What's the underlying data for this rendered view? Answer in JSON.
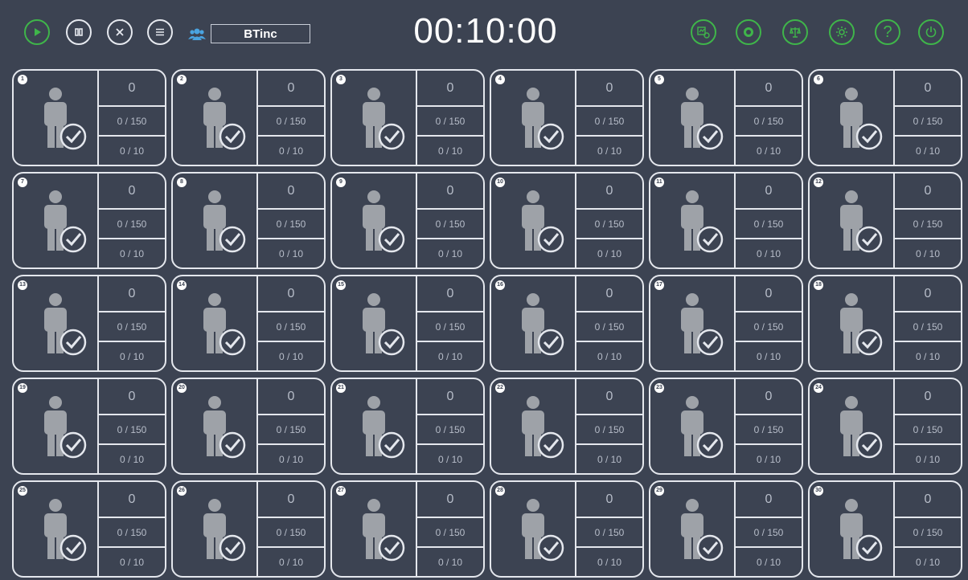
{
  "toolbar": {
    "left_buttons": [
      {
        "name": "play-button",
        "icon": "play-icon"
      },
      {
        "name": "pause-button",
        "icon": "pause-icon"
      },
      {
        "name": "stop-button",
        "icon": "close-icon"
      },
      {
        "name": "menu-button",
        "icon": "menu-icon"
      }
    ],
    "user_icon": "users-icon",
    "user_label": "BTinc",
    "timer": "00:10:00",
    "right_buttons": [
      {
        "name": "stats-button",
        "icon": "stats-icon"
      },
      {
        "name": "record-button",
        "icon": "record-icon"
      },
      {
        "name": "balance-button",
        "icon": "balance-icon"
      },
      {
        "name": "settings-button",
        "icon": "settings-icon"
      },
      {
        "name": "help-button",
        "icon": "help-icon",
        "glyph": "?"
      },
      {
        "name": "power-button",
        "icon": "power-icon"
      }
    ]
  },
  "colors": {
    "background": "#3c4352",
    "accent_green": "#3fb54a",
    "border": "#e4e7ed",
    "figure": "#9ea2a8",
    "value_text": "#b7bdc9",
    "user_icon": "#4aa3e0"
  },
  "stations": [
    {
      "number": "1",
      "value": "0",
      "progress": "0 / 150",
      "count": "0 / 10"
    },
    {
      "number": "2",
      "value": "0",
      "progress": "0 / 150",
      "count": "0 / 10"
    },
    {
      "number": "3",
      "value": "0",
      "progress": "0 / 150",
      "count": "0 / 10"
    },
    {
      "number": "4",
      "value": "0",
      "progress": "0 / 150",
      "count": "0 / 10"
    },
    {
      "number": "5",
      "value": "0",
      "progress": "0 / 150",
      "count": "0 / 10"
    },
    {
      "number": "6",
      "value": "0",
      "progress": "0 / 150",
      "count": "0 / 10"
    },
    {
      "number": "7",
      "value": "0",
      "progress": "0 / 150",
      "count": "0 / 10"
    },
    {
      "number": "8",
      "value": "0",
      "progress": "0 / 150",
      "count": "0 / 10"
    },
    {
      "number": "9",
      "value": "0",
      "progress": "0 / 150",
      "count": "0 / 10"
    },
    {
      "number": "10",
      "value": "0",
      "progress": "0 / 150",
      "count": "0 / 10"
    },
    {
      "number": "11",
      "value": "0",
      "progress": "0 / 150",
      "count": "0 / 10"
    },
    {
      "number": "12",
      "value": "0",
      "progress": "0 / 150",
      "count": "0 / 10"
    },
    {
      "number": "13",
      "value": "0",
      "progress": "0 / 150",
      "count": "0 / 10"
    },
    {
      "number": "14",
      "value": "0",
      "progress": "0 / 150",
      "count": "0 / 10"
    },
    {
      "number": "15",
      "value": "0",
      "progress": "0 / 150",
      "count": "0 / 10"
    },
    {
      "number": "16",
      "value": "0",
      "progress": "0 / 150",
      "count": "0 / 10"
    },
    {
      "number": "17",
      "value": "0",
      "progress": "0 / 150",
      "count": "0 / 10"
    },
    {
      "number": "18",
      "value": "0",
      "progress": "0 / 150",
      "count": "0 / 10"
    },
    {
      "number": "19",
      "value": "0",
      "progress": "0 / 150",
      "count": "0 / 10"
    },
    {
      "number": "20",
      "value": "0",
      "progress": "0 / 150",
      "count": "0 / 10"
    },
    {
      "number": "21",
      "value": "0",
      "progress": "0 / 150",
      "count": "0 / 10"
    },
    {
      "number": "22",
      "value": "0",
      "progress": "0 / 150",
      "count": "0 / 10"
    },
    {
      "number": "23",
      "value": "0",
      "progress": "0 / 150",
      "count": "0 / 10"
    },
    {
      "number": "24",
      "value": "0",
      "progress": "0 / 150",
      "count": "0 / 10"
    },
    {
      "number": "25",
      "value": "0",
      "progress": "0 / 150",
      "count": "0 / 10"
    },
    {
      "number": "26",
      "value": "0",
      "progress": "0 / 150",
      "count": "0 / 10"
    },
    {
      "number": "27",
      "value": "0",
      "progress": "0 / 150",
      "count": "0 / 10"
    },
    {
      "number": "28",
      "value": "0",
      "progress": "0 / 150",
      "count": "0 / 10"
    },
    {
      "number": "29",
      "value": "0",
      "progress": "0 / 150",
      "count": "0 / 10"
    },
    {
      "number": "30",
      "value": "0",
      "progress": "0 / 150",
      "count": "0 / 10"
    }
  ]
}
